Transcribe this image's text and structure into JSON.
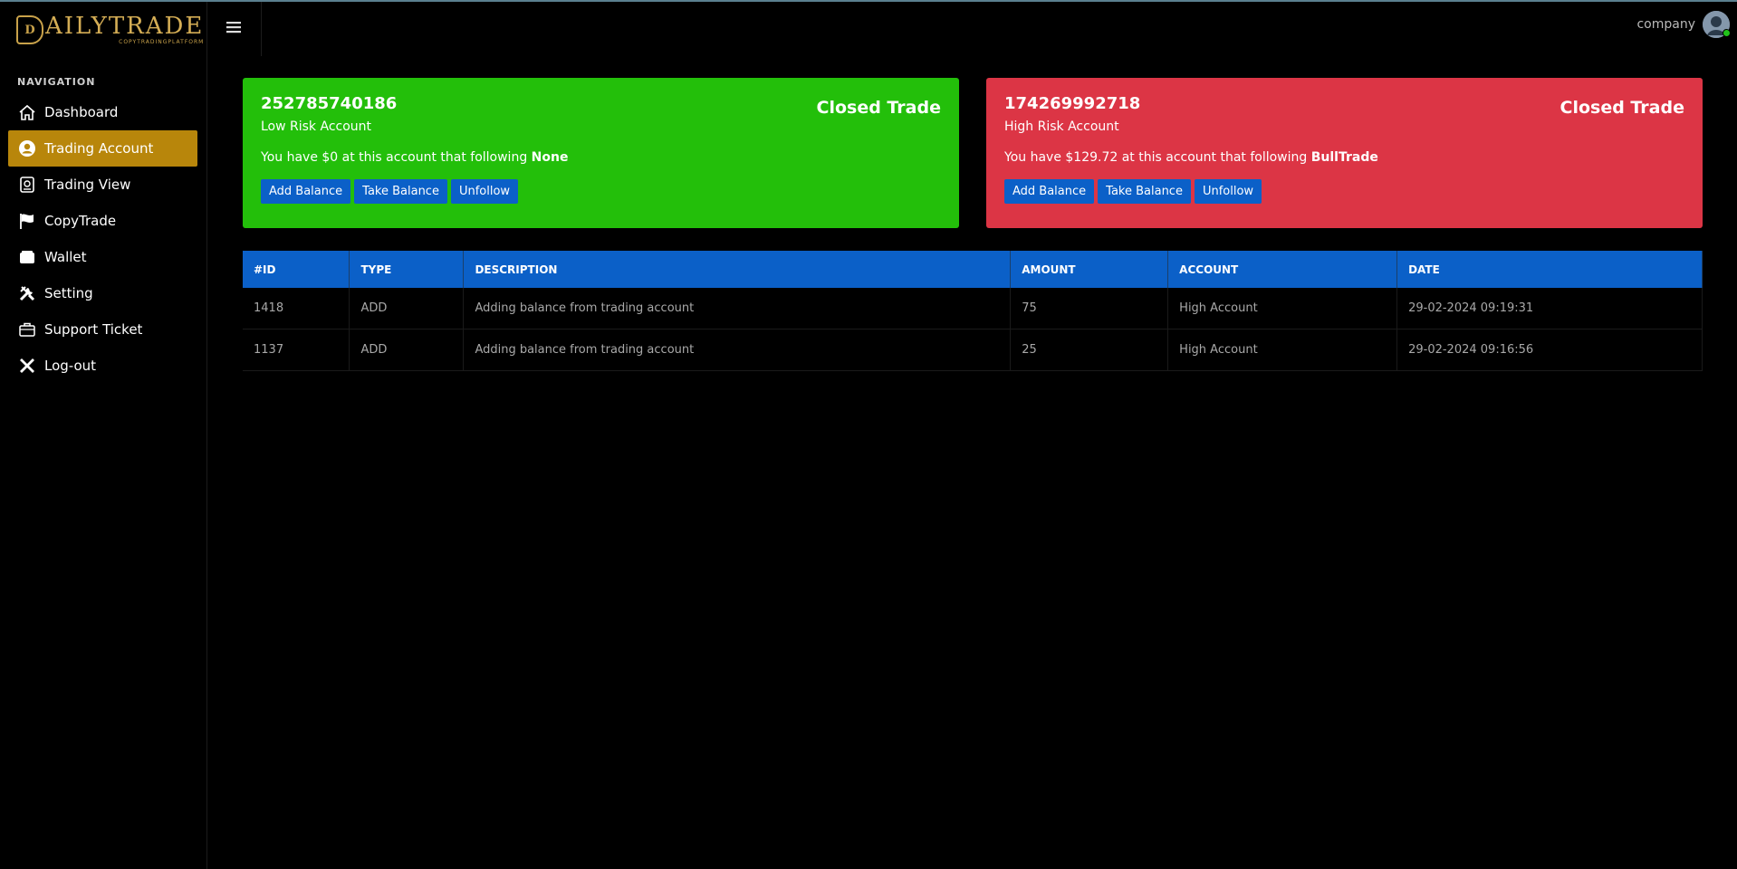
{
  "brand": {
    "title": "AILYTRADE",
    "mark": "D",
    "subtitle": "COPYTRADINGPLATFORM"
  },
  "header": {
    "username": "company"
  },
  "sidebar": {
    "heading": "NAVIGATION",
    "items": [
      {
        "label": "Dashboard",
        "icon": "home-icon"
      },
      {
        "label": "Trading Account",
        "icon": "user-circle-icon",
        "active": true
      },
      {
        "label": "Trading View",
        "icon": "chart-icon"
      },
      {
        "label": "CopyTrade",
        "icon": "flag-icon"
      },
      {
        "label": "Wallet",
        "icon": "wallet-icon"
      },
      {
        "label": "Setting",
        "icon": "tools-icon"
      },
      {
        "label": "Support Ticket",
        "icon": "briefcase-icon"
      },
      {
        "label": "Log-out",
        "icon": "close-icon"
      }
    ]
  },
  "accounts": [
    {
      "id": "252785740186",
      "type": "Low Risk Account",
      "status": "Closed Trade",
      "text_prefix": "You have $0 at this account that following ",
      "following": "None",
      "color": "#23bf0a",
      "buttons": [
        "Add Balance",
        "Take Balance",
        "Unfollow"
      ]
    },
    {
      "id": "174269992718",
      "type": "High Risk Account",
      "status": "Closed Trade",
      "text_prefix": "You have $129.72 at this account that following ",
      "following": "BullTrade",
      "color": "#dc3545",
      "buttons": [
        "Add Balance",
        "Take Balance",
        "Unfollow"
      ]
    }
  ],
  "table": {
    "columns": [
      "#ID",
      "TYPE",
      "DESCRIPTION",
      "AMOUNT",
      "ACCOUNT",
      "DATE"
    ],
    "rows": [
      [
        "1418",
        "ADD",
        "Adding balance from trading account",
        "75",
        "High Account",
        "29-02-2024 09:19:31"
      ],
      [
        "1137",
        "ADD",
        "Adding balance from trading account",
        "25",
        "High Account",
        "29-02-2024 09:16:56"
      ]
    ]
  },
  "colors": {
    "accent": "#b8860b",
    "primary": "#0b60c8",
    "success": "#23bf0a",
    "danger": "#dc3545"
  }
}
